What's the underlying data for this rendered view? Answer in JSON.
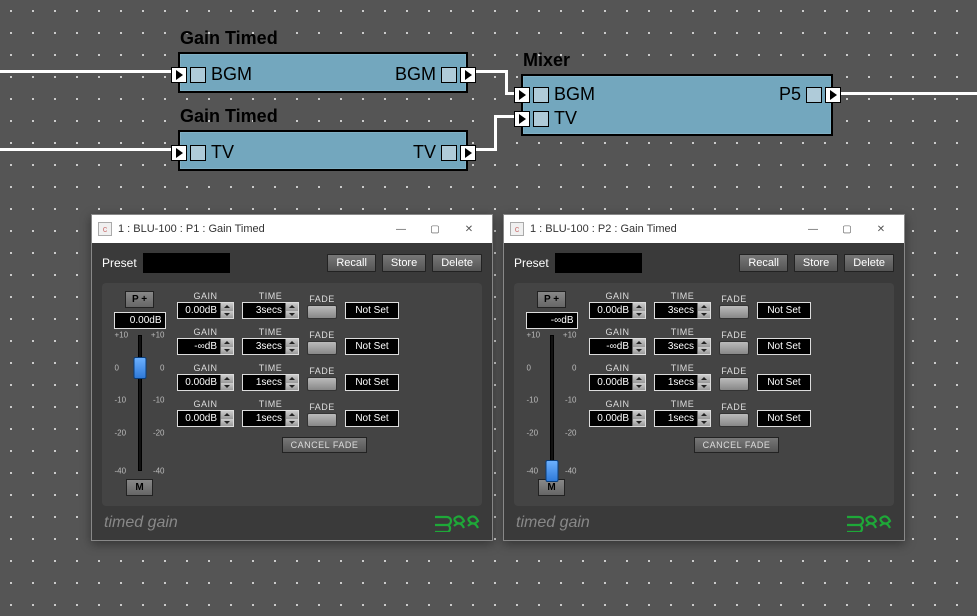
{
  "nodes": {
    "gain_bgm": {
      "title": "Gain Timed",
      "in_label": "BGM",
      "out_label": "BGM"
    },
    "gain_tv": {
      "title": "Gain Timed",
      "in_label": "TV",
      "out_label": "TV"
    },
    "mixer": {
      "title": "Mixer",
      "in1": "BGM",
      "in2": "TV",
      "out": "P5"
    }
  },
  "panels": [
    {
      "title": "1 : BLU-100 : P1 : Gain Timed",
      "preset_label": "Preset",
      "recall": "Recall",
      "store": "Store",
      "delete": "Delete",
      "pplus": "P +",
      "db_readout": "0.00dB",
      "fader_knob_pct": 24,
      "fader_ticks": [
        "+10",
        "0",
        "-10",
        "-20",
        "-40"
      ],
      "mute": "M",
      "rows": [
        {
          "gain": "0.00dB",
          "time": "3secs",
          "status": "Not Set"
        },
        {
          "gain": "-∞dB",
          "time": "3secs",
          "status": "Not Set"
        },
        {
          "gain": "0.00dB",
          "time": "1secs",
          "status": "Not Set"
        },
        {
          "gain": "0.00dB",
          "time": "1secs",
          "status": "Not Set"
        }
      ],
      "headers": {
        "gain": "GAIN",
        "time": "TIME",
        "fade": "FADE"
      },
      "cancel": "CANCEL FADE",
      "footer": "timed gain"
    },
    {
      "title": "1 : BLU-100 : P2 : Gain Timed",
      "preset_label": "Preset",
      "recall": "Recall",
      "store": "Store",
      "delete": "Delete",
      "pplus": "P +",
      "db_readout": "-∞dB",
      "fader_knob_pct": 100,
      "fader_ticks": [
        "+10",
        "0",
        "-10",
        "-20",
        "-40"
      ],
      "mute": "M",
      "rows": [
        {
          "gain": "0.00dB",
          "time": "3secs",
          "status": "Not Set"
        },
        {
          "gain": "-∞dB",
          "time": "3secs",
          "status": "Not Set"
        },
        {
          "gain": "0.00dB",
          "time": "1secs",
          "status": "Not Set"
        },
        {
          "gain": "0.00dB",
          "time": "1secs",
          "status": "Not Set"
        }
      ],
      "headers": {
        "gain": "GAIN",
        "time": "TIME",
        "fade": "FADE"
      },
      "cancel": "CANCEL FADE",
      "footer": "timed gain"
    }
  ]
}
